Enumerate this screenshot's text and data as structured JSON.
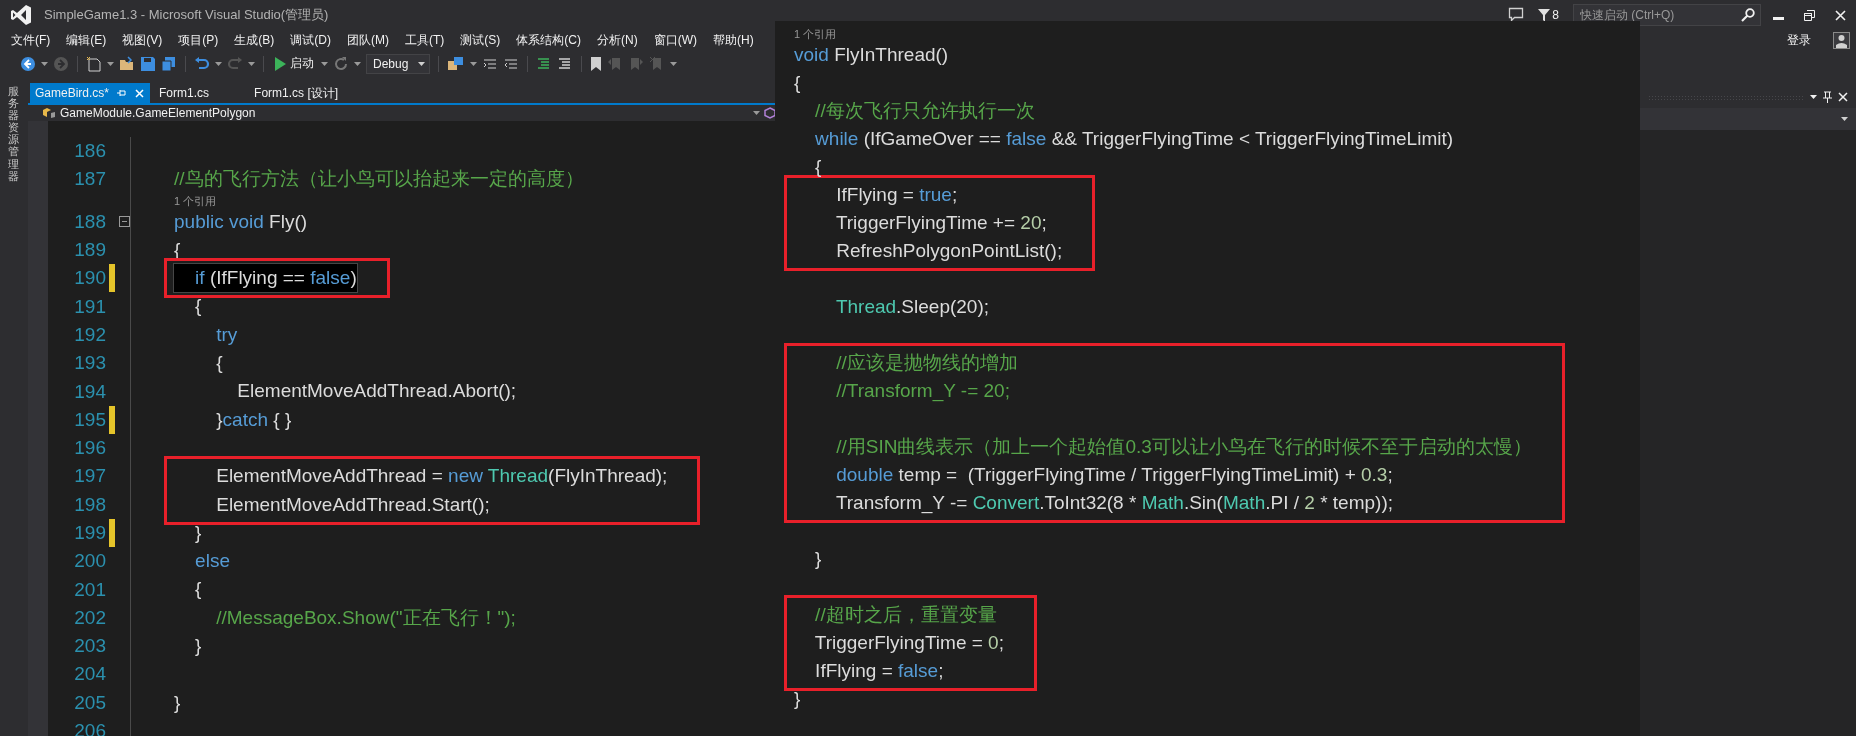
{
  "window": {
    "title": "SimpleGame1.3 - Microsoft Visual Studio(管理员)",
    "notification_count": "8"
  },
  "quick_launch": {
    "placeholder": "快速启动 (Ctrl+Q)"
  },
  "menu": [
    "文件(F)",
    "编辑(E)",
    "视图(V)",
    "项目(P)",
    "生成(B)",
    "调试(D)",
    "团队(M)",
    "工具(T)",
    "测试(S)",
    "体系结构(C)",
    "分析(N)",
    "窗口(W)",
    "帮助(H)"
  ],
  "toolbar": {
    "start_label": "启动",
    "configuration": "Debug"
  },
  "account": {
    "sign_in": "登录"
  },
  "side_tab": "服务器资源管理器",
  "tabs": [
    {
      "label": "GameBird.cs*",
      "selected": true
    },
    {
      "label": "Form1.cs",
      "selected": false
    },
    {
      "label": "Form1.cs [设计]",
      "selected": false
    }
  ],
  "navigation_bar": {
    "type": "GameModule.GameElementPolygon"
  },
  "editor": {
    "groups": [
      {
        "highlighted": false,
        "lines": [
          {
            "kind": "code",
            "number": "186",
            "modified": false,
            "current": false,
            "foldable": false
          },
          {
            "kind": "code",
            "number": "187",
            "modified": false,
            "current": false,
            "foldable": false,
            "tokens": [
              {
                "kind": "comment",
                "text": "//鸟的飞行方法（让小鸟可以抬起来一定的高度）"
              }
            ]
          },
          {
            "kind": "lens",
            "text": "1 个引用"
          },
          {
            "kind": "code",
            "number": "188",
            "modified": false,
            "current": false,
            "foldable": true,
            "tokens": [
              {
                "kind": "keyword",
                "text": "public void"
              },
              {
                "kind": "plain",
                "text": " Fly()"
              }
            ]
          },
          {
            "kind": "code",
            "number": "189",
            "modified": false,
            "current": false,
            "foldable": false,
            "tokens": [
              {
                "kind": "plain",
                "text": "{"
              }
            ]
          }
        ]
      },
      {
        "highlighted": true,
        "lines": [
          {
            "kind": "code",
            "number": "190",
            "modified": true,
            "current": true,
            "foldable": false,
            "tokens": [
              {
                "kind": "keyword",
                "text": "    if"
              },
              {
                "kind": "plain",
                "text": " (IfFlying == "
              },
              {
                "kind": "keyword",
                "text": "false"
              },
              {
                "kind": "plain",
                "text": ")"
              }
            ]
          }
        ]
      },
      {
        "highlighted": false,
        "lines": [
          {
            "kind": "code",
            "number": "191",
            "modified": false,
            "current": false,
            "foldable": false,
            "tokens": [
              {
                "kind": "plain",
                "text": "    {"
              }
            ]
          },
          {
            "kind": "code",
            "number": "192",
            "modified": false,
            "current": false,
            "foldable": false,
            "tokens": [
              {
                "kind": "keyword",
                "text": "        try"
              }
            ]
          },
          {
            "kind": "code",
            "number": "193",
            "modified": false,
            "current": false,
            "foldable": false,
            "tokens": [
              {
                "kind": "plain",
                "text": "        {"
              }
            ]
          },
          {
            "kind": "code",
            "number": "194",
            "modified": false,
            "current": false,
            "foldable": false,
            "tokens": [
              {
                "kind": "plain",
                "text": "            ElementMoveAddThread.Abort();"
              }
            ]
          },
          {
            "kind": "code",
            "number": "195",
            "modified": true,
            "current": false,
            "foldable": false,
            "tokens": [
              {
                "kind": "plain",
                "text": "        }"
              },
              {
                "kind": "keyword",
                "text": "catch"
              },
              {
                "kind": "plain",
                "text": " { }"
              }
            ]
          },
          {
            "kind": "code",
            "number": "196",
            "modified": false,
            "current": false,
            "foldable": false
          }
        ]
      },
      {
        "highlighted": true,
        "lines": [
          {
            "kind": "code",
            "number": "197",
            "modified": false,
            "current": false,
            "foldable": false,
            "tokens": [
              {
                "kind": "plain",
                "text": "        ElementMoveAddThread = "
              },
              {
                "kind": "keyword",
                "text": "new "
              },
              {
                "kind": "type",
                "text": "Thread"
              },
              {
                "kind": "plain",
                "text": "(FlyInThread);"
              }
            ]
          },
          {
            "kind": "code",
            "number": "198",
            "modified": false,
            "current": false,
            "foldable": false,
            "tokens": [
              {
                "kind": "plain",
                "text": "        ElementMoveAddThread.Start();"
              }
            ]
          }
        ]
      },
      {
        "highlighted": false,
        "lines": [
          {
            "kind": "code",
            "number": "199",
            "modified": true,
            "current": false,
            "foldable": false,
            "tokens": [
              {
                "kind": "plain",
                "text": "    }"
              }
            ]
          },
          {
            "kind": "code",
            "number": "200",
            "modified": false,
            "current": false,
            "foldable": false,
            "tokens": [
              {
                "kind": "keyword",
                "text": "    else"
              }
            ]
          },
          {
            "kind": "code",
            "number": "201",
            "modified": false,
            "current": false,
            "foldable": false,
            "tokens": [
              {
                "kind": "plain",
                "text": "    {"
              }
            ]
          },
          {
            "kind": "code",
            "number": "202",
            "modified": false,
            "current": false,
            "foldable": false,
            "tokens": [
              {
                "kind": "comment",
                "text": "        //MessageBox.Show(\"正在飞行！\");"
              }
            ]
          },
          {
            "kind": "code",
            "number": "203",
            "modified": false,
            "current": false,
            "foldable": false,
            "tokens": [
              {
                "kind": "plain",
                "text": "    }"
              }
            ]
          },
          {
            "kind": "code",
            "number": "204",
            "modified": false,
            "current": false,
            "foldable": false
          },
          {
            "kind": "code",
            "number": "205",
            "modified": false,
            "current": false,
            "foldable": false,
            "tokens": [
              {
                "kind": "plain",
                "text": "}"
              }
            ]
          },
          {
            "kind": "code",
            "number": "206",
            "modified": false,
            "current": false,
            "foldable": false
          }
        ]
      }
    ]
  },
  "popup": {
    "groups": [
      {
        "highlighted": false,
        "lines": [
          {
            "kind": "lens",
            "text": "1 个引用"
          },
          {
            "kind": "code",
            "tokens": [
              {
                "kind": "keyword",
                "text": "void"
              },
              {
                "kind": "plain",
                "text": " FlyInThread()"
              }
            ]
          },
          {
            "kind": "code",
            "tokens": [
              {
                "kind": "plain",
                "text": "{"
              }
            ]
          },
          {
            "kind": "code",
            "tokens": [
              {
                "kind": "comment",
                "text": "    //每次飞行只允许执行一次"
              }
            ]
          },
          {
            "kind": "code",
            "tokens": [
              {
                "kind": "keyword",
                "text": "    while"
              },
              {
                "kind": "plain",
                "text": " (IfGameOver == "
              },
              {
                "kind": "keyword",
                "text": "false"
              },
              {
                "kind": "plain",
                "text": " && TriggerFlyingTime < TriggerFlyingTimeLimit)"
              }
            ]
          },
          {
            "kind": "code",
            "tokens": [
              {
                "kind": "plain",
                "text": "    {"
              }
            ]
          }
        ]
      },
      {
        "highlighted": true,
        "lines": [
          {
            "kind": "code",
            "tokens": [
              {
                "kind": "plain",
                "text": "        IfFlying = "
              },
              {
                "kind": "keyword",
                "text": "true"
              },
              {
                "kind": "plain",
                "text": ";"
              }
            ]
          },
          {
            "kind": "code",
            "tokens": [
              {
                "kind": "plain",
                "text": "        TriggerFlyingTime += "
              },
              {
                "kind": "number",
                "text": "20"
              },
              {
                "kind": "plain",
                "text": ";"
              }
            ]
          },
          {
            "kind": "code",
            "tokens": [
              {
                "kind": "plain",
                "text": "        RefreshPolygonPointList();"
              }
            ]
          }
        ]
      },
      {
        "highlighted": false,
        "lines": [
          {
            "kind": "code"
          },
          {
            "kind": "code",
            "tokens": [
              {
                "kind": "type",
                "text": "        Thread"
              },
              {
                "kind": "plain",
                "text": ".Sleep(20);"
              }
            ]
          },
          {
            "kind": "code"
          }
        ]
      },
      {
        "highlighted": true,
        "lines": [
          {
            "kind": "code",
            "tokens": [
              {
                "kind": "comment",
                "text": "        //应该是抛物线的增加"
              }
            ]
          },
          {
            "kind": "code",
            "tokens": [
              {
                "kind": "comment",
                "text": "        //Transform_Y -= 20;"
              }
            ]
          },
          {
            "kind": "code"
          },
          {
            "kind": "code",
            "tokens": [
              {
                "kind": "comment",
                "text": "        //用SIN曲线表示（加上一个起始值0.3可以让小鸟在飞行的时候不至于启动的太慢）"
              }
            ]
          },
          {
            "kind": "code",
            "tokens": [
              {
                "kind": "keyword",
                "text": "        double"
              },
              {
                "kind": "plain",
                "text": " temp =  (TriggerFlyingTime / TriggerFlyingTimeLimit) + "
              },
              {
                "kind": "number",
                "text": "0.3"
              },
              {
                "kind": "plain",
                "text": ";"
              }
            ]
          },
          {
            "kind": "code",
            "tokens": [
              {
                "kind": "plain",
                "text": "        Transform_Y -= "
              },
              {
                "kind": "type",
                "text": "Convert"
              },
              {
                "kind": "plain",
                "text": ".ToInt32(8 * "
              },
              {
                "kind": "type",
                "text": "Math"
              },
              {
                "kind": "plain",
                "text": ".Sin("
              },
              {
                "kind": "type",
                "text": "Math"
              },
              {
                "kind": "plain",
                "text": ".PI / "
              },
              {
                "kind": "number",
                "text": "2"
              },
              {
                "kind": "plain",
                "text": " * temp));"
              }
            ]
          }
        ]
      },
      {
        "highlighted": false,
        "lines": [
          {
            "kind": "code"
          },
          {
            "kind": "code",
            "tokens": [
              {
                "kind": "plain",
                "text": "    }"
              }
            ]
          },
          {
            "kind": "code"
          }
        ]
      },
      {
        "highlighted": true,
        "lines": [
          {
            "kind": "code",
            "tokens": [
              {
                "kind": "comment",
                "text": "    //超时之后，重置变量"
              }
            ]
          },
          {
            "kind": "code",
            "tokens": [
              {
                "kind": "plain",
                "text": "    TriggerFlyingTime = "
              },
              {
                "kind": "number",
                "text": "0"
              },
              {
                "kind": "plain",
                "text": ";"
              }
            ]
          },
          {
            "kind": "code",
            "tokens": [
              {
                "kind": "plain",
                "text": "    IfFlying = "
              },
              {
                "kind": "keyword",
                "text": "false"
              },
              {
                "kind": "plain",
                "text": ";"
              }
            ]
          }
        ]
      },
      {
        "highlighted": false,
        "lines": [
          {
            "kind": "code",
            "tokens": [
              {
                "kind": "plain",
                "text": "}"
              }
            ]
          }
        ]
      }
    ]
  }
}
